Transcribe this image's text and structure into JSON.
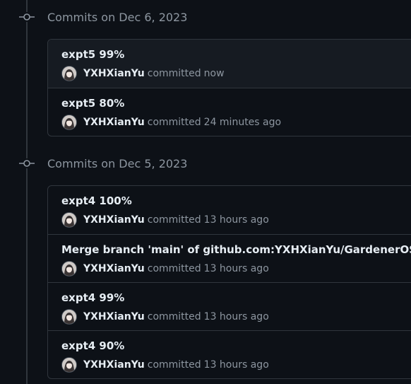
{
  "groups": [
    {
      "title": "Commits on Dec 6, 2023",
      "commits": [
        {
          "message": "expt5 99%",
          "author": "YXHXianYu",
          "verb": "committed",
          "time": "now",
          "highlight": true
        },
        {
          "message": "expt5 80%",
          "author": "YXHXianYu",
          "verb": "committed",
          "time": "24 minutes ago",
          "highlight": false
        }
      ]
    },
    {
      "title": "Commits on Dec 5, 2023",
      "commits": [
        {
          "message": "expt4 100%",
          "author": "YXHXianYu",
          "verb": "committed",
          "time": "13 hours ago",
          "highlight": false
        },
        {
          "message": "Merge branch 'main' of github.com:YXHXianYu/GardenerOS",
          "author": "YXHXianYu",
          "verb": "committed",
          "time": "13 hours ago",
          "highlight": false
        },
        {
          "message": "expt4 99%",
          "author": "YXHXianYu",
          "verb": "committed",
          "time": "13 hours ago",
          "highlight": false
        },
        {
          "message": "expt4 90%",
          "author": "YXHXianYu",
          "verb": "committed",
          "time": "13 hours ago",
          "highlight": false
        }
      ]
    }
  ],
  "icons": {
    "commit_node": "git-commit-icon",
    "avatar": "avatar"
  },
  "colors": {
    "background": "#0d1117",
    "border": "#30363d",
    "muted_text": "#8d96a0",
    "primary_text": "#e6edf3",
    "highlight_row": "#161b22"
  }
}
